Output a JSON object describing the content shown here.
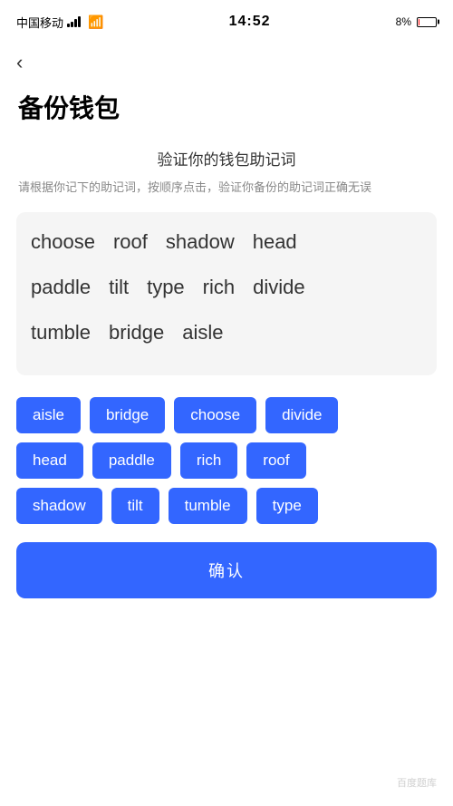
{
  "statusBar": {
    "carrier": "中国移动",
    "time": "14:52",
    "battery": "8%",
    "batteryLow": true
  },
  "nav": {
    "backIcon": "‹"
  },
  "page": {
    "title": "备份钱包",
    "sectionTitle": "验证你的钱包助记词",
    "sectionDesc": "请根据你记下的助记词，按顺序点击，验证你备份的助记词正确无误"
  },
  "wordGrid": {
    "rows": [
      [
        "choose",
        "roof",
        "shadow",
        "head"
      ],
      [
        "paddle",
        "tilt",
        "type",
        "rich",
        "divide"
      ],
      [
        "tumble",
        "bridge",
        "aisle"
      ]
    ]
  },
  "chips": {
    "rows": [
      [
        "aisle",
        "bridge",
        "choose",
        "divide"
      ],
      [
        "head",
        "paddle",
        "rich",
        "roof"
      ],
      [
        "shadow",
        "tilt",
        "tumble",
        "type"
      ]
    ]
  },
  "confirmBtn": {
    "label": "确认"
  },
  "watermark": {
    "text": "百度题库"
  }
}
